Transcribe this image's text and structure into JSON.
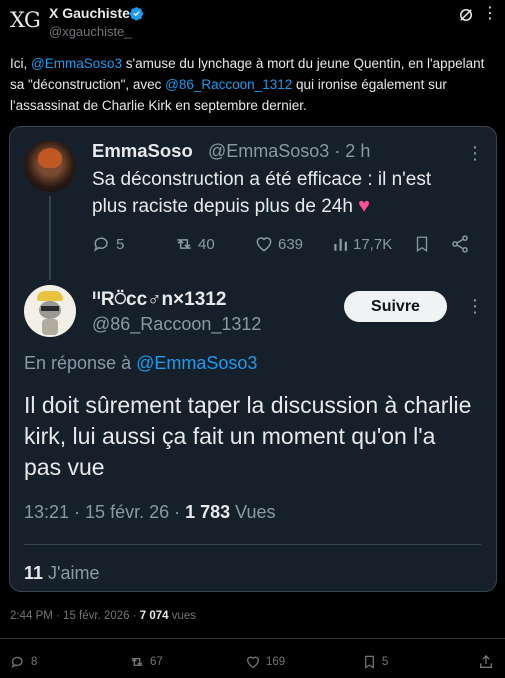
{
  "outer": {
    "avatar_text": "XG",
    "display_name": "X Gauchiste",
    "handle": "@xgauchiste_",
    "body": [
      {
        "t": "Ici, ",
        "link": false
      },
      {
        "t": "@EmmaSoso3",
        "link": true
      },
      {
        "t": " s'amuse du lynchage à mort du jeune Quentin, en l'appelant sa \"déconstruction\", avec ",
        "link": false
      },
      {
        "t": "@86_Raccoon_1312",
        "link": true
      },
      {
        "t": " qui ironise également sur l'assassinat de Charlie Kirk en septembre dernier.",
        "link": false
      }
    ],
    "timestamp": "2:44 PM · 15 févr. 2026 · ",
    "views_count": "7 074",
    "views_label": " vues",
    "actions": {
      "replies": "8",
      "retweets": "67",
      "likes": "169",
      "bookmarks": "5"
    }
  },
  "parent_tweet": {
    "display_name": "EmmaSoso",
    "handle_time": "@EmmaSoso3 · 2 h",
    "text": "Sa déconstruction a été efficace : il n'est plus raciste depuis plus de 24h",
    "emoji": "♥",
    "actions": {
      "replies": "5",
      "retweets": "40",
      "likes": "639",
      "views": "17,7K"
    }
  },
  "reply_tweet": {
    "display_name": "ᐦR⍥cc♂n×1312",
    "handle": "@86_Raccoon_1312",
    "follow_label": "Suivre",
    "reply_prefix": "En réponse à ",
    "reply_to": "@EmmaSoso3",
    "text": "Il doit sûrement taper la discussion à charlie kirk, lui aussi ça fait un moment qu'on l'a pas vue",
    "time": "13:21 · 15 févr. 26 · ",
    "views_count": "1 783",
    "views_label": " Vues",
    "likes_count": "11",
    "likes_label": " J'aime"
  },
  "colors": {
    "accent": "#1d9bf0",
    "verified": "#1d9bf0",
    "heart": "#f91880",
    "card_bg": "#15202b"
  }
}
